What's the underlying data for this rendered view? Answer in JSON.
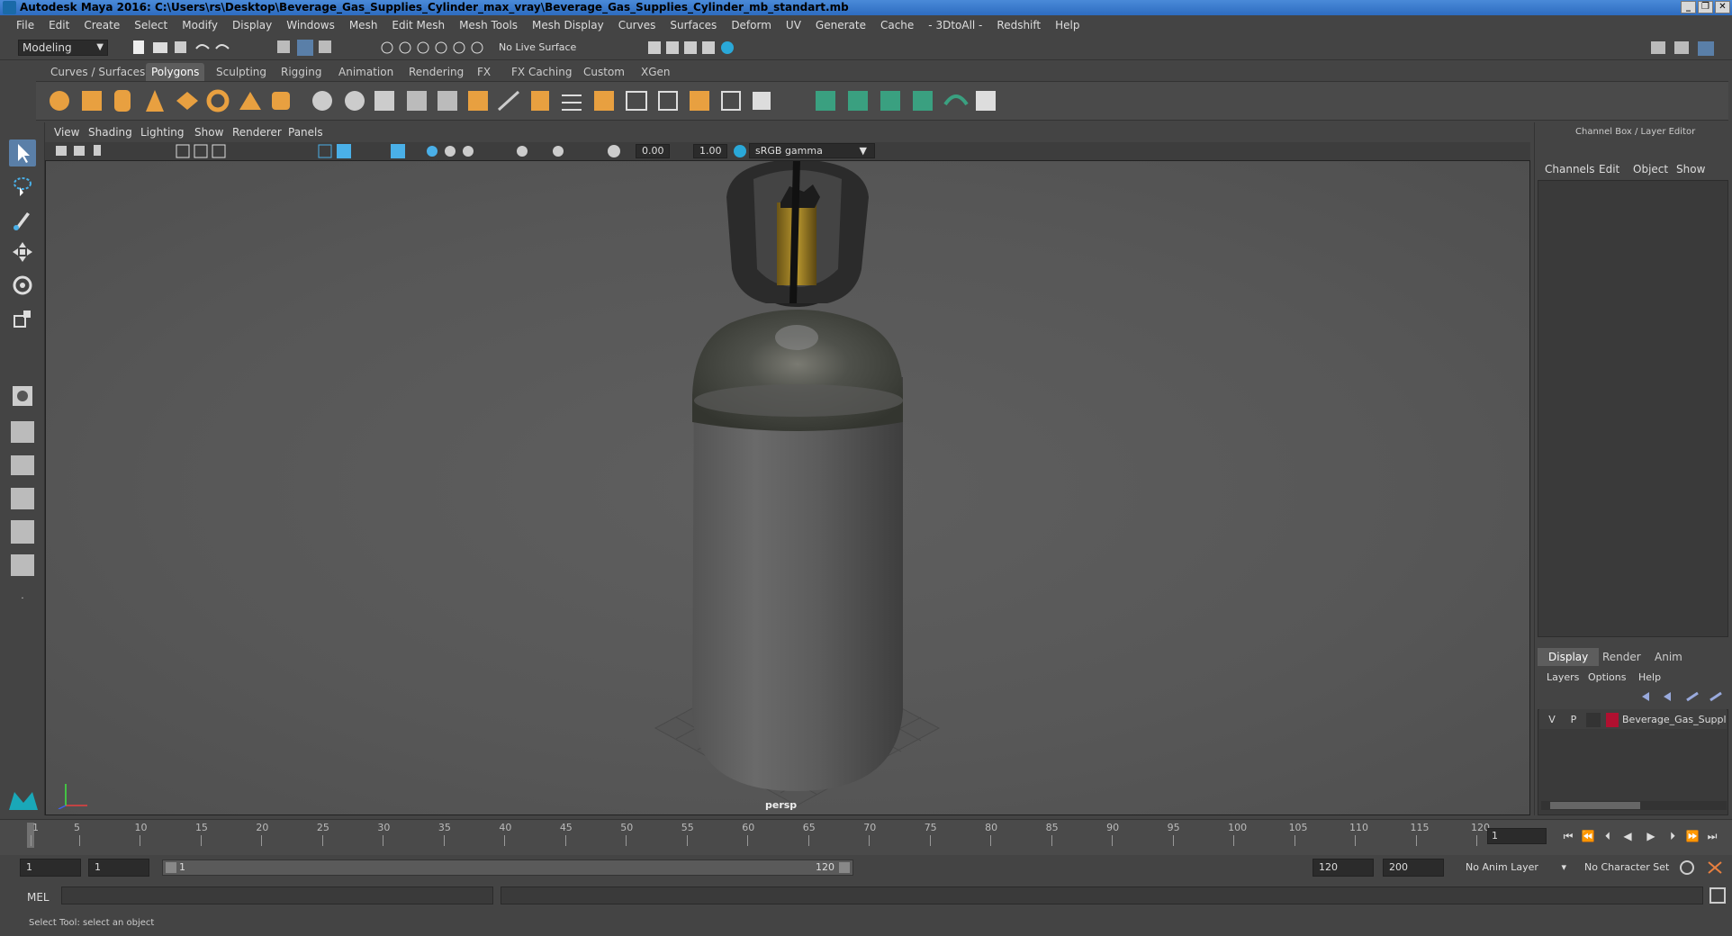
{
  "window": {
    "title": "Autodesk Maya 2016: C:\\Users\\rs\\Desktop\\Beverage_Gas_Supplies_Cylinder_max_vray\\Beverage_Gas_Supplies_Cylinder_mb_standart.mb",
    "controls": [
      "_",
      "❐",
      "✕"
    ]
  },
  "menubar": [
    "File",
    "Edit",
    "Create",
    "Select",
    "Modify",
    "Display",
    "Windows",
    "Mesh",
    "Edit Mesh",
    "Mesh Tools",
    "Mesh Display",
    "Curves",
    "Surfaces",
    "Deform",
    "UV",
    "Generate",
    "Cache",
    "- 3DtoAll -",
    "Redshift",
    "Help"
  ],
  "status_line": {
    "mode": "Modeling",
    "live_surface": "No Live Surface"
  },
  "shelf": {
    "tabs": [
      "Curves / Surfaces",
      "Polygons",
      "Sculpting",
      "Rigging",
      "Animation",
      "Rendering",
      "FX",
      "FX Caching",
      "Custom",
      "XGen"
    ],
    "active_tab": "Polygons"
  },
  "viewport": {
    "menu": [
      "View",
      "Shading",
      "Lighting",
      "Show",
      "Renderer",
      "Panels"
    ],
    "exposure": "0.00",
    "gamma_value": "1.00",
    "color_space": "sRGB gamma",
    "camera_label": "persp"
  },
  "channel_box": {
    "title": "Channel Box / Layer Editor",
    "menu": [
      "Channels",
      "Edit",
      "Object",
      "Show"
    ]
  },
  "layer_editor": {
    "tabs": [
      "Display",
      "Render",
      "Anim"
    ],
    "active_tab": "Display",
    "menu": [
      "Layers",
      "Options",
      "Help"
    ],
    "layers": [
      {
        "v": "V",
        "p": "P",
        "color": "#b01030",
        "name": "Beverage_Gas_Supplie"
      }
    ]
  },
  "timeline": {
    "ticks": [
      "1",
      "5",
      "10",
      "15",
      "20",
      "25",
      "30",
      "35",
      "40",
      "45",
      "50",
      "55",
      "60",
      "65",
      "70",
      "75",
      "80",
      "85",
      "90",
      "95",
      "100",
      "105",
      "110",
      "115",
      "120"
    ],
    "current_frame": "1"
  },
  "range": {
    "start": "1",
    "playback_start": "1",
    "slider_start": "1",
    "slider_end": "120",
    "playback_end": "120",
    "end": "200",
    "anim_layer": "No Anim Layer",
    "character_set": "No Character Set"
  },
  "command_line": {
    "label": "MEL"
  },
  "help_line": {
    "text": "Select Tool: select an object"
  }
}
